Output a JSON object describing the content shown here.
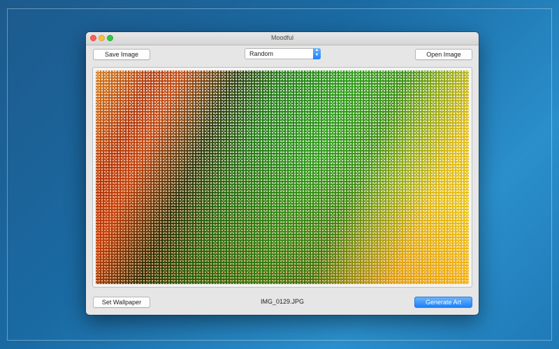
{
  "window": {
    "title": "Moodful"
  },
  "toolbar": {
    "save_label": "Save Image",
    "open_label": "Open Image",
    "mode_select": {
      "value": "Random"
    }
  },
  "footer": {
    "wallpaper_label": "Set Wallpaper",
    "filename": "IMG_0129.JPG",
    "generate_label": "Generate Art"
  },
  "colors": {
    "accent": "#1a82fb",
    "close": "#fc605c",
    "minimize": "#fdbc40",
    "maximize": "#34c84a"
  },
  "icons": {
    "select_stepper": "chevron-up-down-icon"
  }
}
